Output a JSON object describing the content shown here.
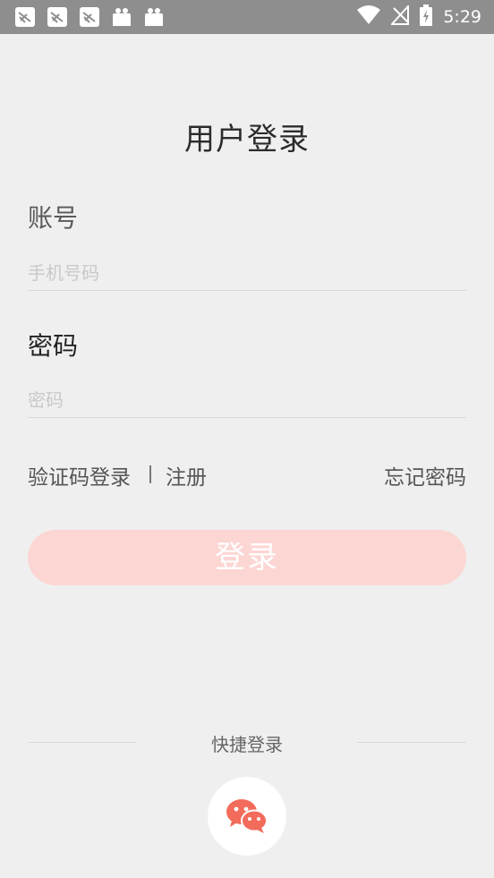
{
  "status_bar": {
    "time": "5:29",
    "notification_icons": [
      "app-notification-icon",
      "app-notification-icon",
      "app-notification-icon",
      "shopping-bag-icon",
      "shopping-bag-icon"
    ],
    "right_icons": [
      "wifi-icon",
      "no-signal-icon",
      "battery-charging-icon"
    ]
  },
  "page": {
    "title": "用户登录"
  },
  "account": {
    "label": "账号",
    "placeholder": "手机号码",
    "value": ""
  },
  "password": {
    "label": "密码",
    "placeholder": "密码",
    "value": ""
  },
  "links": {
    "code_login": "验证码登录",
    "register": "注册",
    "forgot": "忘记密码"
  },
  "login_button": {
    "label": "登录",
    "color": "#fcd6d3"
  },
  "quick_login": {
    "label": "快捷登录",
    "wechat_icon": "wechat-icon",
    "wechat_color": "#f26b5b"
  }
}
